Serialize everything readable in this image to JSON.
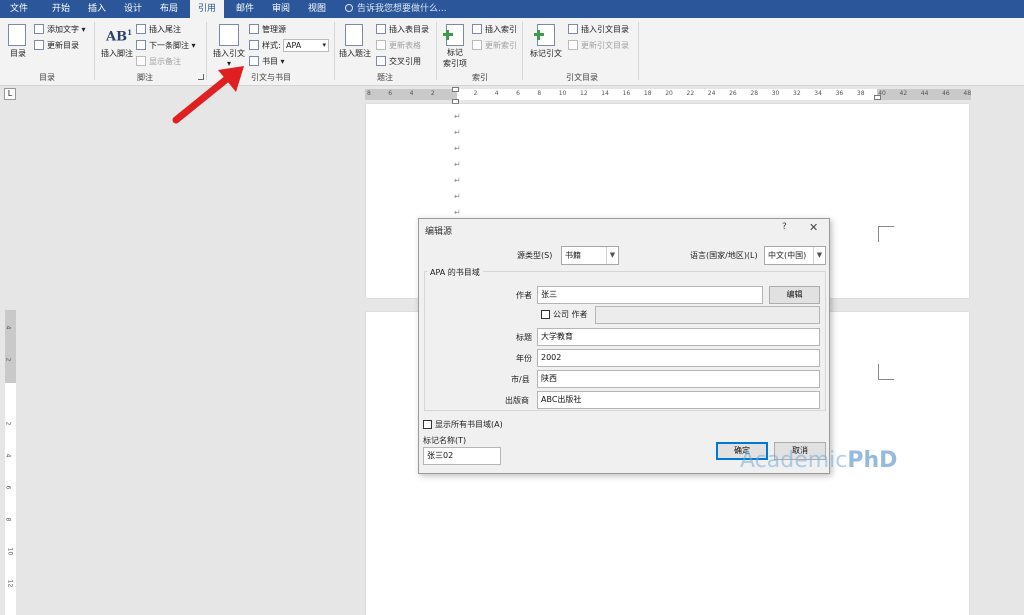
{
  "tabs": [
    "文件",
    "开始",
    "插入",
    "设计",
    "布局",
    "引用",
    "邮件",
    "审阅",
    "视图"
  ],
  "active_tab": "引用",
  "tell_me": "告诉我您想要做什么...",
  "ribbon": {
    "toc": {
      "button": "目录",
      "add_text": "添加文字 ▾",
      "update": "更新目录",
      "group": "目录"
    },
    "footnotes": {
      "insert": "插入脚注",
      "insert_endnote": "插入尾注",
      "next": "下一条脚注 ▾",
      "show": "显示备注",
      "group": "脚注"
    },
    "citations": {
      "insert": "插入引文",
      "manage": "管理源",
      "style_label": "样式:",
      "style_value": "APA",
      "bibliography": "书目 ▾",
      "group": "引文与书目"
    },
    "captions": {
      "insert": "插入题注",
      "insert_tof": "插入表目录",
      "update_table": "更新表格",
      "cross_ref": "交叉引用",
      "group": "题注"
    },
    "index": {
      "mark": "标记\n索引项",
      "insert": "插入索引",
      "update": "更新索引",
      "group": "索引"
    },
    "toa": {
      "mark": "标记引文",
      "insert": "插入引文目录",
      "update": "更新引文目录",
      "group": "引文目录"
    }
  },
  "ruler_marks": [
    "8",
    "6",
    "4",
    "2",
    "",
    "2",
    "4",
    "6",
    "8",
    "10",
    "12",
    "14",
    "16",
    "18",
    "20",
    "22",
    "24",
    "26",
    "28",
    "30",
    "32",
    "34",
    "36",
    "38",
    "40",
    "42",
    "44",
    "46",
    "48"
  ],
  "vruler_marks": [
    "4",
    "2",
    "",
    "2",
    "4",
    "6",
    "8",
    "10",
    "12"
  ],
  "dialog": {
    "title": "编辑源",
    "help": "?",
    "close": "✕",
    "source_type_label": "源类型(S)",
    "source_type": "书籍",
    "language_label": "语言(国家/地区)(L)",
    "language": "中文(中国)",
    "group_title": "APA 的书目域",
    "author_label": "作者",
    "author": "张三",
    "edit_button": "编辑",
    "corporate_label": "公司 作者",
    "title_label": "标题",
    "title_value": "大学教育",
    "year_label": "年份",
    "year": "2002",
    "city_label": "市/县",
    "city": "陕西",
    "publisher_label": "出版商",
    "publisher": "ABC出版社",
    "show_all_label": "显示所有书目域(A)",
    "tag_label": "标记名称(T)",
    "tag": "张三02",
    "ok": "确定",
    "cancel": "取消"
  },
  "watermark": {
    "a": "Academic",
    "b": "PhD"
  },
  "colors": {
    "tabbar": "#2b579a",
    "ribbon": "#f3f3f3",
    "arrow": "#e02020"
  }
}
